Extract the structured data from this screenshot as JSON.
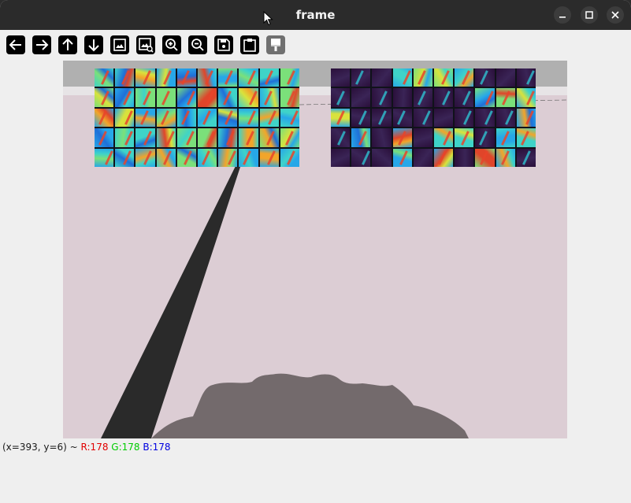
{
  "window": {
    "title": "frame"
  },
  "toolbar": {
    "buttons": [
      {
        "name": "pan-left",
        "icon": "arrow-left-icon"
      },
      {
        "name": "pan-right",
        "icon": "arrow-right-icon"
      },
      {
        "name": "pan-up",
        "icon": "arrow-up-icon"
      },
      {
        "name": "pan-down",
        "icon": "arrow-down-icon"
      },
      {
        "name": "zoom-in-fit",
        "icon": "image-fit-icon"
      },
      {
        "name": "zoom-original",
        "icon": "image-zoom-icon"
      },
      {
        "name": "zoom-in",
        "icon": "zoom-in-icon"
      },
      {
        "name": "zoom-out",
        "icon": "zoom-out-icon"
      },
      {
        "name": "save",
        "icon": "save-icon"
      },
      {
        "name": "copy-to-clipboard",
        "icon": "clipboard-icon"
      },
      {
        "name": "properties",
        "icon": "paint-brush-icon",
        "disabled": true
      }
    ]
  },
  "status": {
    "position": "(x=393, y=6) ~",
    "r": "R:178",
    "g": "G:178",
    "b": "B:178"
  },
  "colors": {
    "titlebar": "#2b2b2b",
    "window_bg": "#efefef",
    "floor": "#dccdd4",
    "horizon": "#b0b0b0",
    "road": "#2a2a2a",
    "hood": "#736a6c",
    "feature_dark": "#2a0f3a"
  }
}
